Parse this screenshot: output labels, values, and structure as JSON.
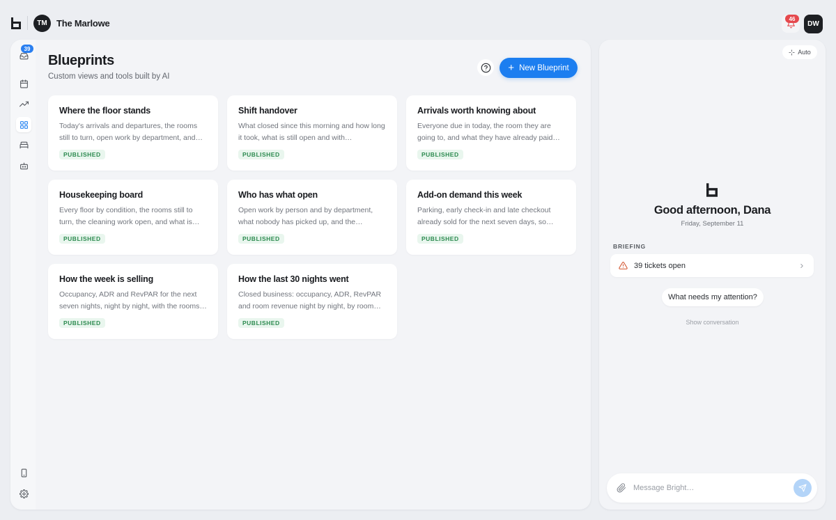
{
  "topbar": {
    "property_initials": "TM",
    "property_name": "The Marlowe",
    "notification_count": "46",
    "user_initials": "DW"
  },
  "rail": {
    "inbox_count": "39",
    "items": [
      {
        "icon": "inbox-icon"
      },
      {
        "icon": "calendar-icon"
      },
      {
        "icon": "trending-icon"
      },
      {
        "icon": "grid-icon",
        "active": true
      },
      {
        "icon": "bed-icon"
      },
      {
        "icon": "robot-icon"
      },
      {
        "icon": "mobile-icon"
      },
      {
        "icon": "gear-icon"
      }
    ]
  },
  "main": {
    "title": "Blueprints",
    "subtitle": "Custom views and tools built by AI",
    "new_button_label": "New Blueprint",
    "cards": [
      {
        "title": "Where the floor stands",
        "description": "Today's arrivals and departures, the rooms still to turn, open work by department, and…",
        "status": "PUBLISHED"
      },
      {
        "title": "Shift handover",
        "description": "What closed since this morning and how long it took, what is still open and with…",
        "status": "PUBLISHED"
      },
      {
        "title": "Arrivals worth knowing about",
        "description": "Everyone due in today, the room they are going to, and what they have already paid…",
        "status": "PUBLISHED"
      },
      {
        "title": "Housekeeping board",
        "description": "Every floor by condition, the rooms still to turn, the cleaning work open, and what is…",
        "status": "PUBLISHED"
      },
      {
        "title": "Who has what open",
        "description": "Open work by person and by department, what nobody has picked up, and the…",
        "status": "PUBLISHED"
      },
      {
        "title": "Add-on demand this week",
        "description": "Parking, early check-in and late checkout already sold for the next seven days, so the…",
        "status": "PUBLISHED"
      },
      {
        "title": "How the week is selling",
        "description": "Occupancy, ADR and RevPAR for the next seven nights, night by night, with the rooms…",
        "status": "PUBLISHED"
      },
      {
        "title": "How the last 30 nights went",
        "description": "Closed business: occupancy, ADR, RevPAR and room revenue night by night, by room…",
        "status": "PUBLISHED"
      }
    ]
  },
  "assistant": {
    "mode_label": "Auto",
    "greeting": "Good afternoon, Dana",
    "date": "Friday, September 11",
    "briefing_label": "BRIEFING",
    "briefing_item": "39 tickets open",
    "suggestion": "What needs my attention?",
    "show_conversation": "Show conversation",
    "composer_placeholder": "Message Bright…",
    "composer_value": ""
  },
  "colors": {
    "accent": "#1c7ef0",
    "published_bg": "#e9f6ee",
    "published_text": "#2c8a4f",
    "alert": "#e5484d"
  }
}
